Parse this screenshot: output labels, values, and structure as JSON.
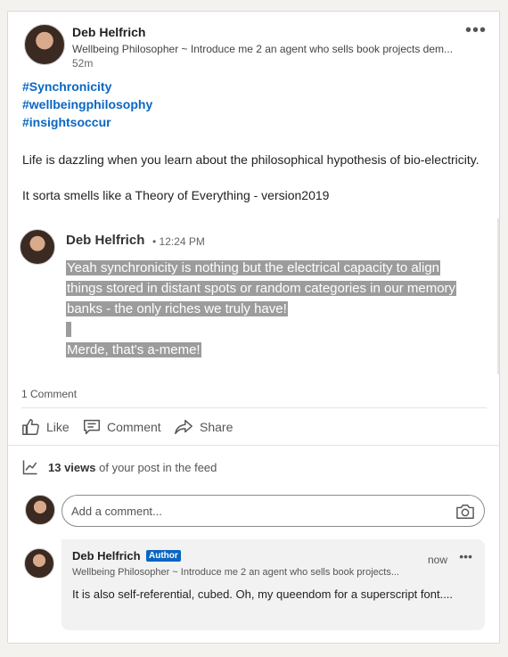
{
  "post": {
    "author_name": "Deb Helfrich",
    "author_headline": "Wellbeing Philosopher ~ Introduce me 2 an agent who sells book projects dem...",
    "time": "52m",
    "more_label": "•••",
    "hashtags": [
      "#Synchronicity",
      "#wellbeingphilosophy",
      "#insightsoccur"
    ],
    "paragraph1": "Life is dazzling when you learn about the philosophical hypothesis of bio-electricity.",
    "paragraph2": "It sorta smells like a Theory of Everything - version2019"
  },
  "quoted_comment": {
    "name": "Deb Helfrich",
    "time": "• 12:24 PM",
    "lines": [
      "Yeah synchronicity is nothing but the electrical capacity to align",
      "things stored in distant spots or random categories in our memory",
      "banks - the only riches we truly have!",
      "Merde, that's a-meme!"
    ]
  },
  "social": {
    "comment_count": "1 Comment",
    "actions": {
      "like": "Like",
      "comment": "Comment",
      "share": "Share"
    },
    "views_count": "13 views",
    "views_suffix": "of your post in the feed"
  },
  "comment_box": {
    "placeholder": "Add a comment..."
  },
  "reply": {
    "name": "Deb Helfrich",
    "badge": "Author",
    "headline": "Wellbeing Philosopher ~ Introduce me 2 an agent who sells book projects...",
    "time": "now",
    "more_label": "•••",
    "text": "It is also self-referential, cubed. Oh, my queendom for a superscript font...."
  },
  "colors": {
    "link_blue": "#0a66c2",
    "highlight_gray": "#9c9c9c"
  },
  "icons": [
    "like-icon",
    "comment-icon",
    "share-icon",
    "analytics-icon",
    "camera-icon"
  ]
}
